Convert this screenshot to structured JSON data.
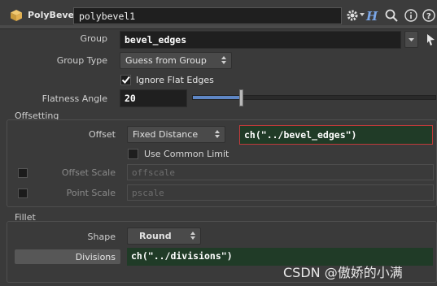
{
  "header": {
    "node_type": "PolyBevel",
    "node_name": "polybevel1",
    "icons": [
      "gear-icon",
      "help-h-icon",
      "search-icon",
      "info-icon",
      "help-icon"
    ]
  },
  "params": {
    "group_label": "Group",
    "group_value": "bevel_edges",
    "group_type_label": "Group Type",
    "group_type_value": "Guess from Group",
    "ignore_flat_label": "Ignore Flat Edges",
    "ignore_flat_checked": true,
    "flatness_label": "Flatness Angle",
    "flatness_value": "20",
    "flatness_slider_fraction": 0.2
  },
  "offsetting": {
    "title": "Offsetting",
    "offset_label": "Offset",
    "offset_mode": "Fixed Distance",
    "offset_expr": "ch(\"../bevel_edges\")",
    "use_common_limit_label": "Use Common Limit",
    "offset_scale_label": "Offset Scale",
    "offset_scale_placeholder": "offscale",
    "point_scale_label": "Point Scale",
    "point_scale_placeholder": "pscale"
  },
  "fillet": {
    "title": "Fillet",
    "shape_label": "Shape",
    "shape_value": "Round",
    "divisions_label": "Divisions",
    "divisions_expr": "ch(\"../divisions\")"
  },
  "watermark": "CSDN @傲娇的小满"
}
